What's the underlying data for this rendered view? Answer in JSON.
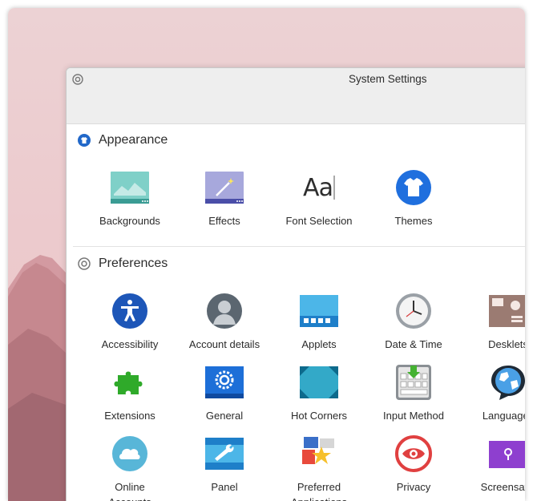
{
  "window": {
    "title": "System Settings"
  },
  "sections": {
    "appearance": {
      "label": "Appearance",
      "items": [
        "Backgrounds",
        "Effects",
        "Font Selection",
        "Themes"
      ]
    },
    "preferences": {
      "label": "Preferences",
      "items": [
        "Accessibility",
        "Account details",
        "Applets",
        "Date & Time",
        "Desklets",
        "Extensions",
        "General",
        "Hot Corners",
        "Input Method",
        "Languages",
        "Online\nAccounts",
        "Panel",
        "Preferred\nApplications",
        "Privacy",
        "Screensave"
      ]
    }
  },
  "font_icon_text": "Aa"
}
